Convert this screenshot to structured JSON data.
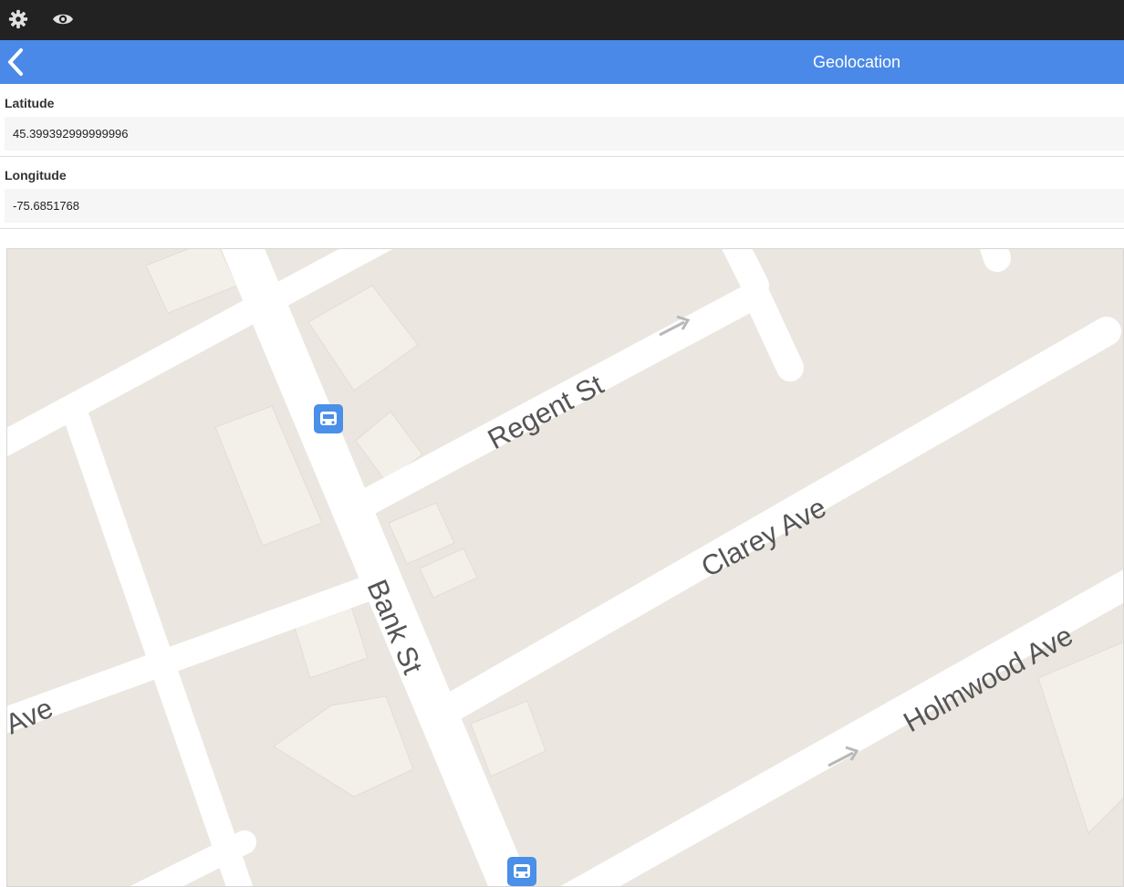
{
  "topbar": {
    "icons": [
      "gear-icon",
      "eye-icon"
    ]
  },
  "header": {
    "back_icon": "chevron-left-icon",
    "title": "Geolocation"
  },
  "fields": {
    "latitude": {
      "label": "Latitude",
      "value": "45.399392999999996"
    },
    "longitude": {
      "label": "Longitude",
      "value": "-75.6851768"
    }
  },
  "map": {
    "streets": {
      "regent": "Regent St",
      "clarey": "Clarey Ave",
      "bank": "Bank St",
      "holmwood": "Holmwood Ave",
      "ave": "Ave"
    },
    "icons": [
      "bus-stop-icon",
      "one-way-arrow-icon"
    ],
    "colors": {
      "land": "#ebe7e0",
      "road": "#ffffff",
      "building": "#f3f0ea",
      "bus": "#4a8fe8"
    }
  }
}
